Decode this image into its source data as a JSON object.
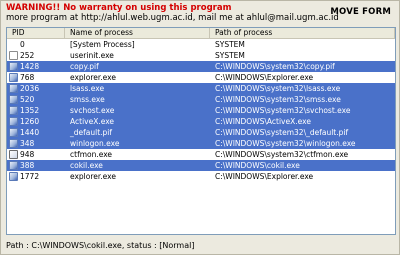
{
  "warning_text": "WARNING!! No warranty on using this program",
  "info_text": "more program at http://ahlul.web.ugm.ac.id, mail me at ahlul@mail.ugm.ac.id",
  "move_label": "MOVE FORM",
  "columns": [
    "PID",
    "Name of process",
    "Path of process"
  ],
  "rows": [
    {
      "pid": "0",
      "name": "[System Process]",
      "path": "SYSTEM",
      "selected": false,
      "icon": "none"
    },
    {
      "pid": "252",
      "name": "userinit.exe",
      "path": "SYSTEM",
      "selected": false,
      "icon": "doc"
    },
    {
      "pid": "1428",
      "name": "copy.pif",
      "path": "C:\\WINDOWS\\system32\\copy.pif",
      "selected": true,
      "icon": "app"
    },
    {
      "pid": "768",
      "name": "explorer.exe",
      "path": "C:\\WINDOWS\\Explorer.exe",
      "selected": false,
      "icon": "app"
    },
    {
      "pid": "2036",
      "name": "lsass.exe",
      "path": "C:\\WINDOWS\\system32\\lsass.exe",
      "selected": true,
      "icon": "app"
    },
    {
      "pid": "520",
      "name": "smss.exe",
      "path": "C:\\WINDOWS\\system32\\smss.exe",
      "selected": true,
      "icon": "app"
    },
    {
      "pid": "1352",
      "name": "svchost.exe",
      "path": "C:\\WINDOWS\\system32\\svchost.exe",
      "selected": true,
      "icon": "app"
    },
    {
      "pid": "1260",
      "name": "ActiveX.exe",
      "path": "C:\\WINDOWS\\ActiveX.exe",
      "selected": true,
      "icon": "app"
    },
    {
      "pid": "1440",
      "name": "_default.pif",
      "path": "C:\\WINDOWS\\system32\\_default.pif",
      "selected": true,
      "icon": "app"
    },
    {
      "pid": "348",
      "name": "winlogon.exe",
      "path": "C:\\WINDOWS\\system32\\winlogon.exe",
      "selected": true,
      "icon": "app"
    },
    {
      "pid": "948",
      "name": "ctfmon.exe",
      "path": "C:\\WINDOWS\\system32\\ctfmon.exe",
      "selected": false,
      "icon": "ctf"
    },
    {
      "pid": "388",
      "name": "cokil.exe",
      "path": "C:\\WINDOWS\\cokil.exe",
      "selected": true,
      "icon": "app"
    },
    {
      "pid": "1772",
      "name": "explorer.exe",
      "path": "C:\\WINDOWS\\Explorer.exe",
      "selected": false,
      "icon": "app"
    }
  ],
  "status_text": "Path : C:\\WINDOWS\\cokil.exe, status : [Normal]",
  "colors": {
    "warning": "#d40000",
    "selection": "#4a71c9",
    "window_bg": "#eceadf"
  }
}
